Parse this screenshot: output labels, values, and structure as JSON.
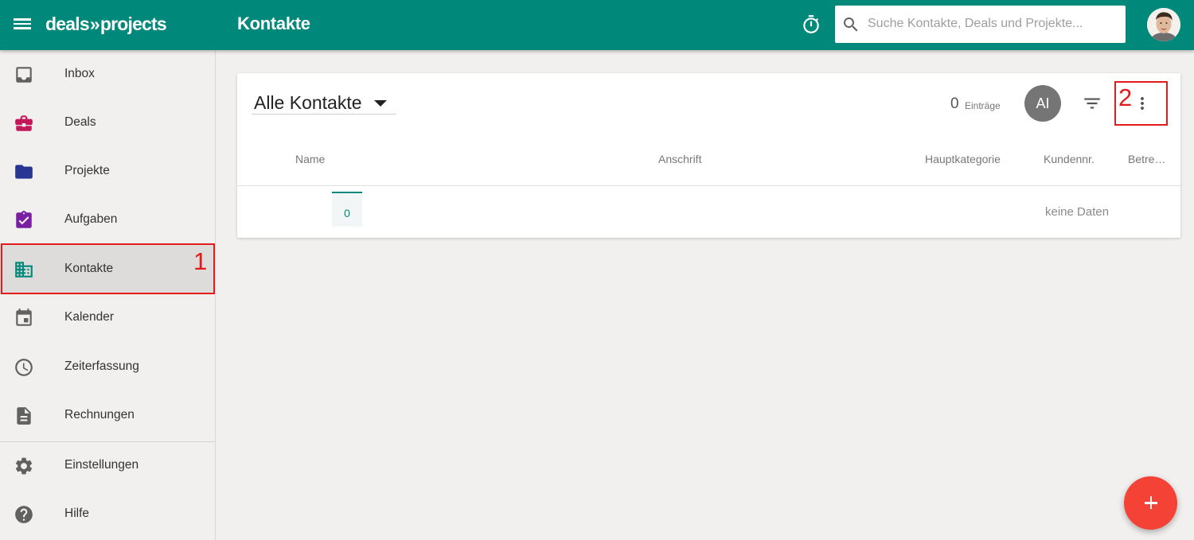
{
  "app": {
    "logo_left": "deals",
    "logo_sep": "»",
    "logo_right": "projects"
  },
  "header": {
    "title": "Kontakte",
    "search_placeholder": "Suche Kontakte, Deals und Projekte...",
    "icons": [
      "menu-icon",
      "timer-icon",
      "search-icon",
      "avatar"
    ]
  },
  "sidebar": {
    "items": [
      {
        "label": "Inbox",
        "icon": "inbox-icon",
        "color": "#616161"
      },
      {
        "label": "Deals",
        "icon": "briefcase-icon",
        "color": "#c2185b"
      },
      {
        "label": "Projekte",
        "icon": "folder-icon",
        "color": "#283593"
      },
      {
        "label": "Aufgaben",
        "icon": "assignment-check-icon",
        "color": "#7b1fa2"
      },
      {
        "label": "Kontakte",
        "icon": "domain-icon",
        "color": "#00897b",
        "active": true
      },
      {
        "label": "Kalender",
        "icon": "calendar-icon",
        "color": "#616161"
      },
      {
        "label": "Zeiterfassung",
        "icon": "clock-icon",
        "color": "#616161"
      },
      {
        "label": "Rechnungen",
        "icon": "document-icon",
        "color": "#616161"
      },
      {
        "label": "Einstellungen",
        "icon": "gear-icon",
        "color": "#616161"
      },
      {
        "label": "Hilfe",
        "icon": "help-icon",
        "color": "#616161"
      }
    ]
  },
  "main": {
    "view_select": "Alle Kontakte",
    "count": "0",
    "count_label": "Einträge",
    "user_initials": "AI",
    "columns": [
      "Name",
      "Anschrift",
      "Hauptkategorie",
      "Kundennr.",
      "Betre…"
    ],
    "page": "0",
    "empty_text": "keine Daten"
  },
  "annotations": [
    "1",
    "2"
  ],
  "colors": {
    "primary": "#00897b",
    "fab": "#f44336",
    "annotation": "#e31b1b"
  }
}
